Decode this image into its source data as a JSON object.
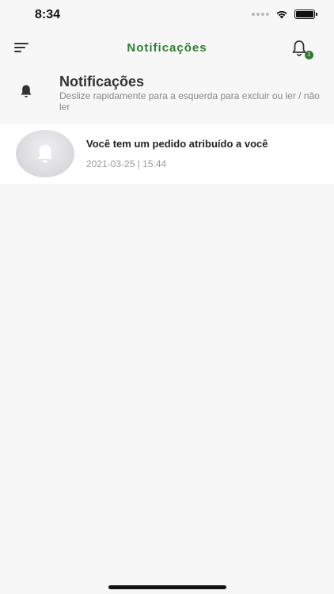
{
  "status": {
    "time": "8:34"
  },
  "nav": {
    "title": "Notificações",
    "badge_count": "1",
    "accent_color": "#2e7d32"
  },
  "section": {
    "title": "Notificações",
    "subtitle": "Deslize rapidamente para a esquerda para excluir ou ler / não ler"
  },
  "notifications": [
    {
      "text": "Você tem um pedido atribuído a você",
      "timestamp": "2021-03-25 | 15:44",
      "icon": "bell-icon"
    }
  ]
}
